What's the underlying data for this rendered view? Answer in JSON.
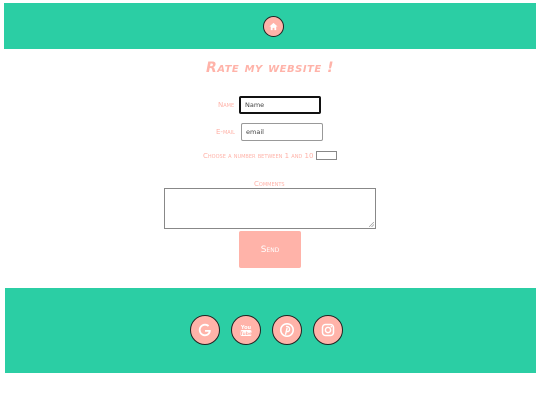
{
  "header": {
    "home_icon": "home-icon"
  },
  "title": "Rate my website !",
  "form": {
    "name_label": "Name",
    "name_value": "Name",
    "email_label": "E-mail",
    "email_placeholder": "email",
    "number_label": "Choose a number between 1 and 10",
    "comments_label": "Comments",
    "send_label": "Send"
  },
  "footer": {
    "icons": [
      "google-icon",
      "youtube-icon",
      "pinterest-icon",
      "instagram-icon"
    ]
  },
  "colors": {
    "accent": "#2bcea4",
    "pink": "#ffb3a9"
  }
}
